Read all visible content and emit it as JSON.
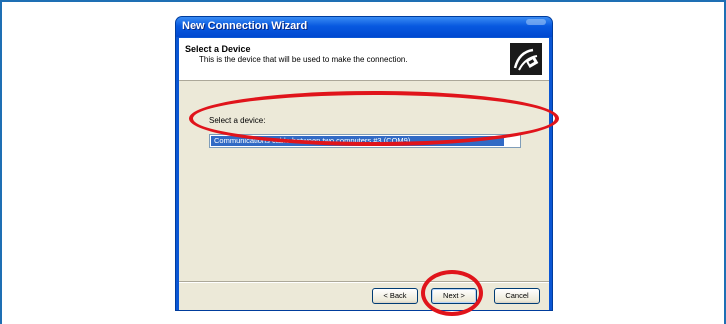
{
  "wizard": {
    "title": "New Connection Wizard",
    "header_title": "Select a Device",
    "header_subtitle": "This is the device that will be used to make the connection.",
    "icon": "modem-cable-icon"
  },
  "device_select": {
    "label": "Select a device:",
    "selected_item": "Communications cable between two computers #3 (COM9)"
  },
  "buttons": {
    "back": "< Back",
    "next": "Next >",
    "cancel": "Cancel"
  },
  "annotations": {
    "highlight_color": "#e0141b"
  }
}
